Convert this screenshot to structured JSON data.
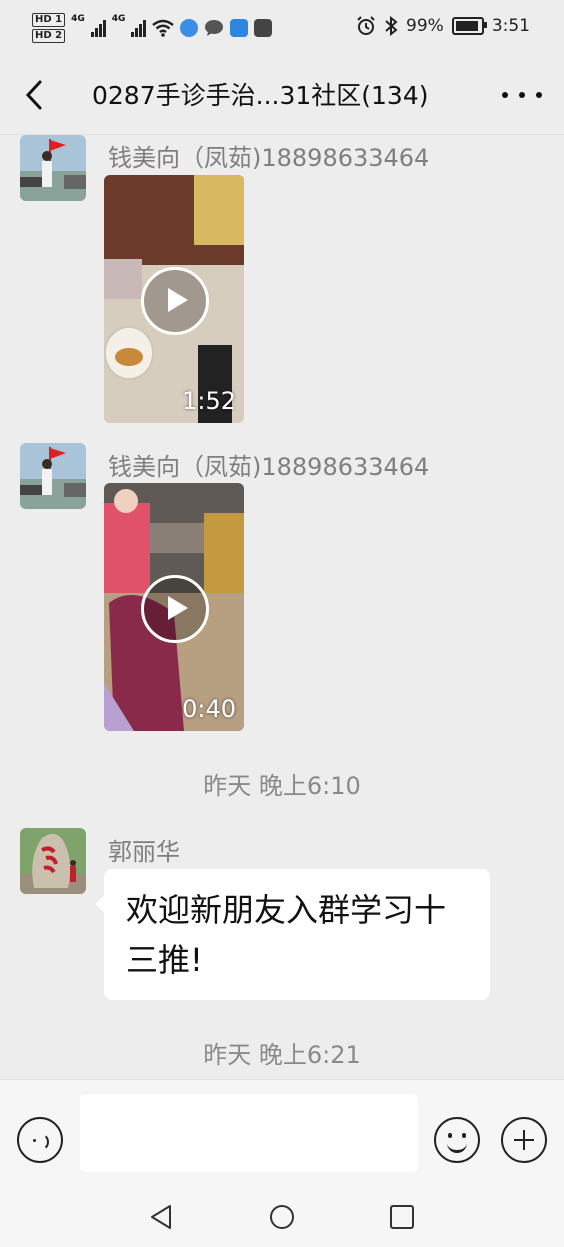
{
  "status_bar": {
    "hd1": "HD 1",
    "hd2": "HD 2",
    "net1": "4G",
    "net2": "4G",
    "battery_percent": "99%",
    "time": "3:51"
  },
  "header": {
    "title": "0287手诊手治...31社区(134)"
  },
  "messages": [
    {
      "sender": "钱美向（凤茹)18898633464",
      "video_duration": "1:52"
    },
    {
      "sender": "钱美向（凤茹)18898633464",
      "video_duration": "0:40"
    }
  ],
  "timestamps": [
    "昨天 晚上6:10",
    "昨天 晚上6:21"
  ],
  "text_message": {
    "sender": "郭丽华",
    "text": "欢迎新朋友入群学习十三推!"
  },
  "colors": {
    "background": "#ededed",
    "bubble": "#ffffff",
    "sender_name": "#7f7f7f",
    "timestamp": "#8a8a8a"
  }
}
